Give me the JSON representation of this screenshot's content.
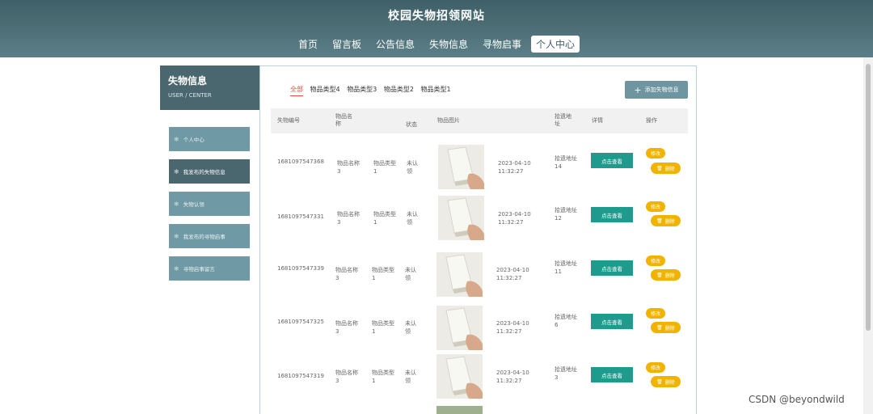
{
  "header": {
    "title": "校园失物招领网站",
    "nav": [
      "首页",
      "留言板",
      "公告信息",
      "失物信息",
      "寻物启事",
      "个人中心"
    ],
    "active_nav": 5
  },
  "sidebar": {
    "title": "失物信息",
    "subtitle": "USER / CENTER",
    "items": [
      {
        "label": "个人中心"
      },
      {
        "label": "我发布的失物信息"
      },
      {
        "label": "失物认领"
      },
      {
        "label": "我发布的寻物启事"
      },
      {
        "label": "寻物启事留言"
      }
    ],
    "active_item": 1
  },
  "content": {
    "tabs": [
      "全部",
      "物品类型4",
      "物品类型3",
      "物品类型2",
      "物品类型1"
    ],
    "active_tab": 0,
    "add_button": "添加失物信息",
    "columns": {
      "id": "失物编号",
      "name": "物品名称",
      "type": "",
      "status": "状态",
      "image": "物品图片",
      "time": "",
      "address": "拾遗地址",
      "detail": "详情",
      "actions": "操作"
    },
    "rows": [
      {
        "id": "1681097547368",
        "name": "物品名称3",
        "type": "物品类型1",
        "status": "未认领",
        "date": "2023-04-10",
        "time": "11:32:27",
        "address": "拾遗地址14",
        "view": "点击查看",
        "edit": "修改",
        "delete": "删除"
      },
      {
        "id": "1681097547331",
        "name": "物品名称3",
        "type": "物品类型1",
        "status": "未认领",
        "date": "2023-04-10",
        "time": "11:32:27",
        "address": "拾遗地址12",
        "view": "点击查看",
        "edit": "修改",
        "delete": "删除"
      },
      {
        "id": "1681097547339",
        "name": "物品名称3",
        "type": "物品类型1",
        "status": "未认领",
        "date": "2023-04-10",
        "time": "11:32:27",
        "address": "拾遗地址11",
        "view": "点击查看",
        "edit": "修改",
        "delete": "删除"
      },
      {
        "id": "1681097547325",
        "name": "物品名称3",
        "type": "物品类型1",
        "status": "未认领",
        "date": "2023-04-10",
        "time": "11:32:27",
        "address": "拾遗地址6",
        "view": "点击查看",
        "edit": "修改",
        "delete": "删除"
      },
      {
        "id": "1681097547319",
        "name": "物品名称3",
        "type": "物品类型1",
        "status": "未认领",
        "date": "2023-04-10",
        "time": "11:32:27",
        "address": "拾遗地址3",
        "view": "点击查看",
        "edit": "修改",
        "delete": "删除"
      }
    ]
  },
  "watermark": "CSDN @beyondwild",
  "colors": {
    "header": "#4d6d75",
    "sidebar_active": "#4a676f",
    "sidebar_item": "#6f9aa5",
    "view_button": "#1f9b8e",
    "action_button": "#f0b400",
    "active_tab": "#e74c3c"
  },
  "icons": {
    "sidebar_item": "snowflake-icon",
    "add": "plus-icon",
    "delete": "trash-icon"
  }
}
